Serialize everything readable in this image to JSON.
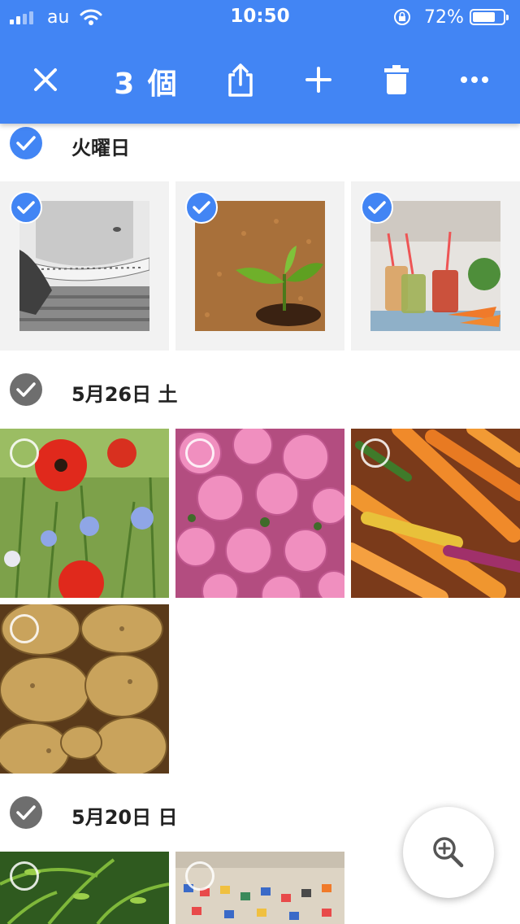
{
  "status_bar": {
    "carrier": "au",
    "time": "10:50",
    "battery_percent": "72%"
  },
  "toolbar": {
    "selected_count": "3 個",
    "icons": [
      "close-icon",
      "share-icon",
      "add-icon",
      "trash-icon",
      "more-icon"
    ]
  },
  "sections": [
    {
      "label": "火曜日",
      "all_selected": true,
      "items": [
        {
          "name": "measuring-tape-photo",
          "selected": true
        },
        {
          "name": "seedling-photo",
          "selected": true
        },
        {
          "name": "smoothies-photo",
          "selected": true
        }
      ]
    },
    {
      "label": "5月26日 土",
      "all_selected": false,
      "items": [
        {
          "name": "poppies-photo",
          "selected": false
        },
        {
          "name": "roses-photo",
          "selected": false
        },
        {
          "name": "carrots-photo",
          "selected": false
        },
        {
          "name": "potatoes-photo",
          "selected": false
        }
      ]
    },
    {
      "label": "5月20日 日",
      "all_selected": false,
      "items": [
        {
          "name": "ferns-photo",
          "selected": false
        },
        {
          "name": "beach-photo",
          "selected": false
        }
      ]
    }
  ],
  "fab": {
    "icon": "zoom-in-icon"
  },
  "colors": {
    "accent": "#4285f4",
    "header_text": "#222222",
    "check_gray": "#6e6e6e"
  }
}
